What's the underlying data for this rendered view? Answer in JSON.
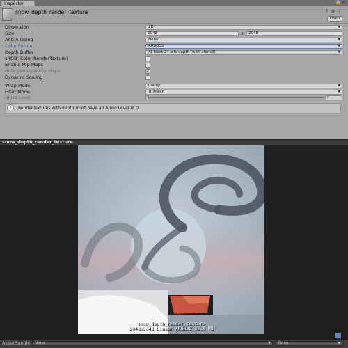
{
  "tab": {
    "label": "Inspector",
    "lock_icon": "lock-icon",
    "menu_icon": "menu-icon"
  },
  "header": {
    "title": "snow_depth_render_texture",
    "icons": [
      "help-icon",
      "settings-icon",
      "menu-icon"
    ],
    "open_label": "Open"
  },
  "properties": {
    "dimension": {
      "label": "Dimension",
      "value": "2D"
    },
    "size": {
      "label": "Size",
      "width": "2048",
      "sep": "x",
      "height": "2048"
    },
    "anti_aliasing": {
      "label": "Anti-Aliasing",
      "value": "None"
    },
    "color_format": {
      "label": "Color Format",
      "value": "ARGB32"
    },
    "depth_buffer": {
      "label": "Depth Buffer",
      "value": "At least 24 bits depth (with stencil)"
    },
    "srgb": {
      "label": "sRGB (Color RenderTexture)",
      "checked": false
    },
    "mip_maps": {
      "label": "Enable Mip Maps",
      "checked": false
    },
    "auto_mip": {
      "label": "Auto generate Mip Maps",
      "checked": true,
      "check_glyph": "✓"
    },
    "dynamic_scaling": {
      "label": "Dynamic Scaling",
      "checked": false
    },
    "wrap_mode": {
      "label": "Wrap Mode",
      "value": "Clamp"
    },
    "filter_mode": {
      "label": "Filter Mode",
      "value": "Trilinear"
    },
    "aniso_level": {
      "label": "Aniso Level",
      "value": "0"
    }
  },
  "help": {
    "icon": "info-icon",
    "glyph": "!",
    "text": "RenderTextures with depth must have an Aniso Level of 0."
  },
  "preview": {
    "title": "snow_depth_render_texture",
    "caption_line1": "snow_depth_render_texture",
    "caption_line2": "2048x2048 Linear  ARGB32  32.0 MB"
  },
  "footer": {
    "label": "AssetBundle",
    "bundle_value": "None",
    "variant_value": "None"
  },
  "colors": {
    "inspector_bg": "#a7a7a7",
    "accent_label": "#2f5da8",
    "preview_bg": "#1f1f1f",
    "texture_bg": "#9fb0bd"
  }
}
